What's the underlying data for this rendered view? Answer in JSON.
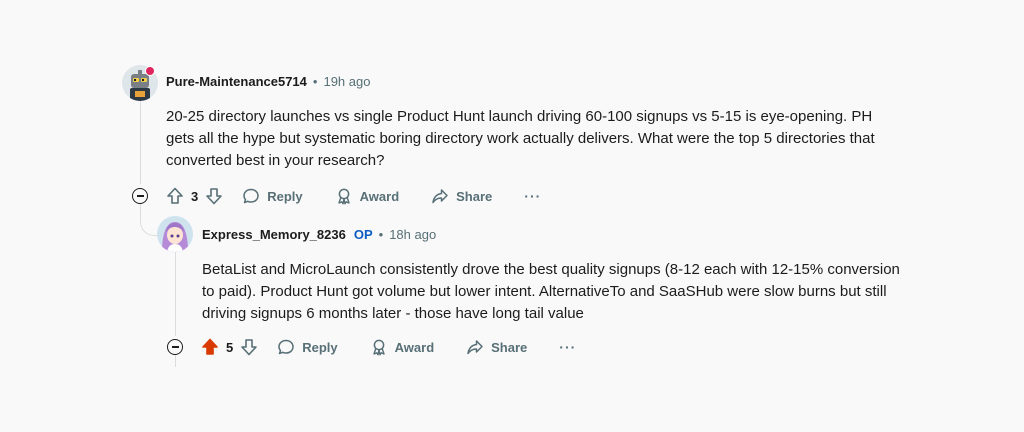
{
  "comments": [
    {
      "username": "Pure-Maintenance5714",
      "op_label": "",
      "separator": "•",
      "time": "19h ago",
      "body_lines": [
        "20-25 directory launches vs single Product Hunt launch driving 60-100 signups vs 5-15 is eye-opening. PH",
        "gets all the hype but systematic boring directory work actually delivers. What were the top 5 directories that",
        "converted best in your research?"
      ],
      "score": "3",
      "upvoted": false,
      "reply_label": "Reply",
      "award_label": "Award",
      "share_label": "Share",
      "more_label": "···"
    },
    {
      "username": "Express_Memory_8236",
      "op_label": "OP",
      "separator": "•",
      "time": "18h ago",
      "body_lines": [
        "BetaList and MicroLaunch consistently drove the best quality signups (8-12 each with 12-15% conversion",
        "to paid). Product Hunt got volume but lower intent. AlternativeTo and SaaSHub were slow burns but still",
        "driving signups 6 months later - those have long tail value"
      ],
      "score": "5",
      "upvoted": true,
      "reply_label": "Reply",
      "award_label": "Award",
      "share_label": "Share",
      "more_label": "···"
    }
  ],
  "colors": {
    "upvote_active": "#d93a00",
    "op_badge": "#0a5dc2",
    "meta_gray": "#576f76",
    "thread_line": "#d9dde0"
  },
  "icons": {
    "upvote": "arrow-up-icon",
    "downvote": "arrow-down-icon",
    "reply": "speech-bubble-icon",
    "award": "award-ribbon-icon",
    "share": "share-arrow-icon",
    "collapse": "minus-circle-icon"
  }
}
